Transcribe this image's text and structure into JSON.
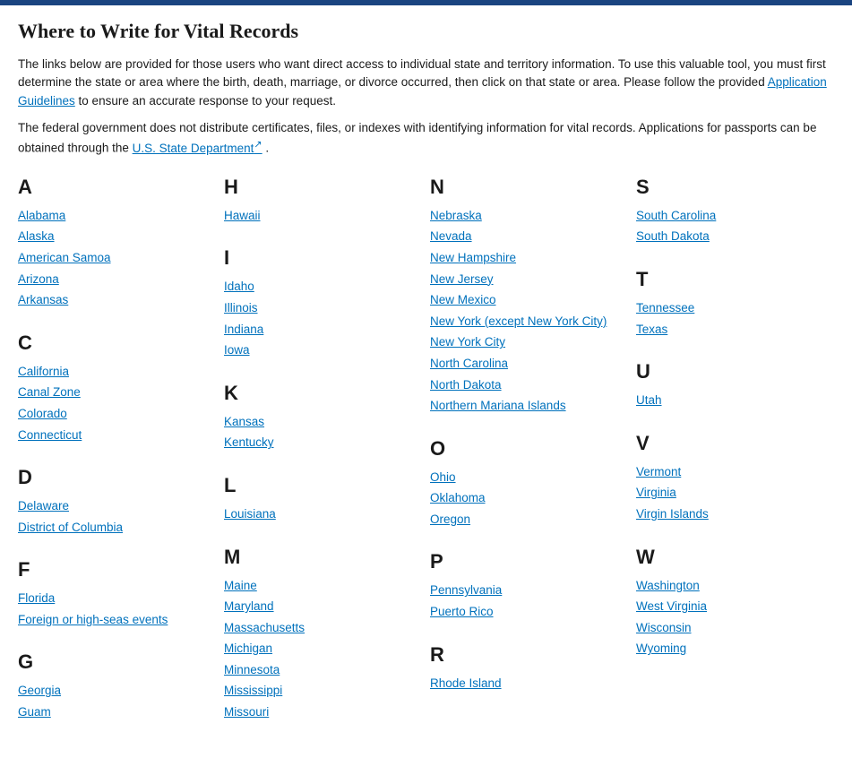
{
  "topbar": {},
  "header": {
    "title": "Where to Write for Vital Records"
  },
  "intro": {
    "text1": "The links below are provided for those users who want direct access to individual state and territory information. To use this valuable tool, you must first determine the state or area where the birth, death, marriage, or divorce occurred, then click on that state or area. Please follow the provided ",
    "link1_label": "Application Guidelines",
    "link1_url": "#",
    "text2": " to ensure an accurate response to your request.",
    "federal_text": "The federal government does not distribute certificates, files, or indexes with identifying information for vital records. Applications for passports can be obtained through the ",
    "link2_label": "U.S. State Department",
    "link2_url": "#",
    "period": " ."
  },
  "columns": [
    {
      "sections": [
        {
          "letter": "A",
          "links": [
            "Alabama",
            "Alaska",
            "American Samoa",
            "Arizona",
            "Arkansas"
          ]
        },
        {
          "letter": "C",
          "links": [
            "California",
            "Canal Zone",
            "Colorado",
            "Connecticut"
          ]
        },
        {
          "letter": "D",
          "links": [
            "Delaware",
            "District of Columbia"
          ]
        },
        {
          "letter": "F",
          "links": [
            "Florida",
            "Foreign or high-seas events"
          ]
        },
        {
          "letter": "G",
          "links": [
            "Georgia",
            "Guam"
          ]
        }
      ]
    },
    {
      "sections": [
        {
          "letter": "H",
          "links": [
            "Hawaii"
          ]
        },
        {
          "letter": "I",
          "links": [
            "Idaho",
            "Illinois",
            "Indiana",
            "Iowa"
          ]
        },
        {
          "letter": "K",
          "links": [
            "Kansas",
            "Kentucky"
          ]
        },
        {
          "letter": "L",
          "links": [
            "Louisiana"
          ]
        },
        {
          "letter": "M",
          "links": [
            "Maine",
            "Maryland",
            "Massachusetts",
            "Michigan",
            "Minnesota",
            "Mississippi",
            "Missouri"
          ]
        }
      ]
    },
    {
      "sections": [
        {
          "letter": "N",
          "links": [
            "Nebraska",
            "Nevada",
            "New Hampshire",
            "New Jersey",
            "New Mexico",
            "New York (except New York City)",
            "New York City",
            "North Carolina",
            "North Dakota",
            "Northern Mariana Islands"
          ]
        },
        {
          "letter": "O",
          "links": [
            "Ohio",
            "Oklahoma",
            "Oregon"
          ]
        },
        {
          "letter": "P",
          "links": [
            "Pennsylvania",
            "Puerto Rico"
          ]
        },
        {
          "letter": "R",
          "links": [
            "Rhode Island"
          ]
        }
      ]
    },
    {
      "sections": [
        {
          "letter": "S",
          "links": [
            "South Carolina",
            "South Dakota"
          ]
        },
        {
          "letter": "T",
          "links": [
            "Tennessee",
            "Texas"
          ]
        },
        {
          "letter": "U",
          "links": [
            "Utah"
          ]
        },
        {
          "letter": "V",
          "links": [
            "Vermont",
            "Virginia",
            "Virgin Islands"
          ]
        },
        {
          "letter": "W",
          "links": [
            "Washington",
            "West Virginia",
            "Wisconsin",
            "Wyoming"
          ]
        }
      ]
    }
  ]
}
